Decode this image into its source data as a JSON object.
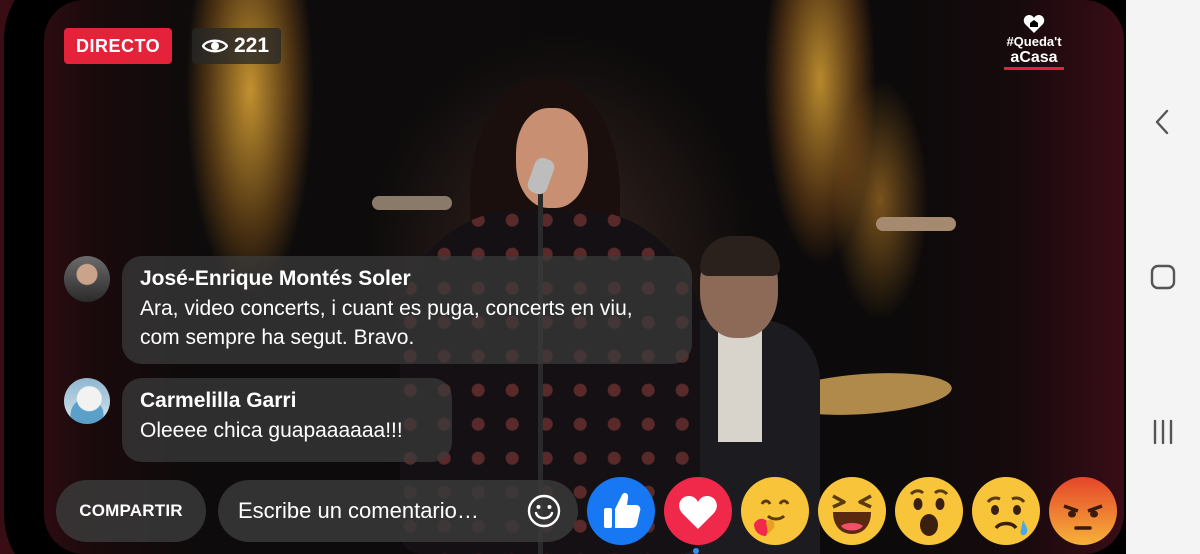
{
  "live": {
    "badge_label": "DIRECTO",
    "viewer_count": "221"
  },
  "brand": {
    "line1": "#Queda't",
    "line2": "aCasa",
    "colors": {
      "accent": "#e4223a"
    }
  },
  "comments": [
    {
      "author": "José-Enrique Montés Soler",
      "text": "Ara, video concerts, i cuant es puga, concerts en viu, com sempre ha segut. Bravo."
    },
    {
      "author": "Carmelilla Garri",
      "text": "Oleeee chica guapaaaaaa!!!"
    }
  ],
  "bottom_bar": {
    "share_label": "COMPARTIR",
    "comment_placeholder": "Escribe un comentario…",
    "emoji_icon": "smiley-icon"
  },
  "reactions": [
    "like",
    "love",
    "care",
    "haha",
    "wow",
    "sad",
    "angry"
  ],
  "navigation": [
    "back-icon",
    "home-icon",
    "recents-icon"
  ],
  "colors": {
    "live_red": "#e4223a",
    "like_blue": "#1877f2",
    "love_red": "#f0284a",
    "reaction_yellow": "#f7c43a"
  }
}
